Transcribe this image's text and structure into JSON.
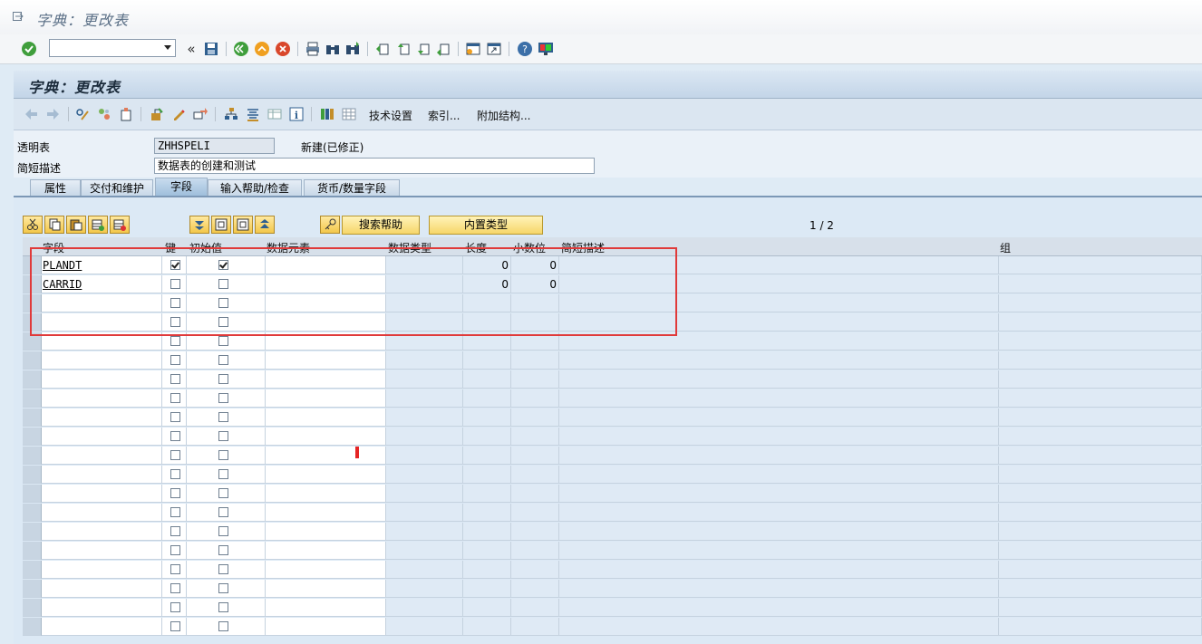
{
  "window": {
    "title": "字典：更改表"
  },
  "system_toolbar": {
    "command_value": "",
    "icons": [
      "enter-icon",
      "back-double-icon",
      "save-icon",
      "back-icon",
      "exit-icon",
      "cancel-icon",
      "print-icon",
      "find-icon",
      "find-next-icon",
      "first-page-icon",
      "prev-page-icon",
      "next-page-icon",
      "last-page-icon",
      "new-session-icon",
      "shortcut-icon",
      "help-icon",
      "layout-icon"
    ]
  },
  "app": {
    "header": "字典：更改表",
    "toolbar_texts": {
      "tech_settings": "技术设置",
      "index": "索引...",
      "append_struct": "附加结构..."
    }
  },
  "form": {
    "table_label": "透明表",
    "table_name": "ZHHSPELI",
    "status": "新建(已修正)",
    "desc_label": "简短描述",
    "desc_value": "数据表的创建和测试"
  },
  "tabs": [
    {
      "label": "属性"
    },
    {
      "label": "交付和维护"
    },
    {
      "label": "字段"
    },
    {
      "label": "输入帮助/检查"
    },
    {
      "label": "货币/数量字段"
    }
  ],
  "active_tab": "字段",
  "grid_toolbar": {
    "search_help": "搜索帮助",
    "builtin_type": "内置类型",
    "pager": "1 / 2"
  },
  "columns": [
    "字段",
    "键",
    "初始值",
    "数据元素",
    "数据类型",
    "长度",
    "小数位",
    "简短描述",
    "组"
  ],
  "rows": [
    {
      "field": "PLANDT",
      "key": true,
      "initial": true,
      "length": "0",
      "decimals": "0"
    },
    {
      "field": "CARRID",
      "key": false,
      "initial": false,
      "length": "0",
      "decimals": "0"
    }
  ],
  "empty_rows": 18
}
